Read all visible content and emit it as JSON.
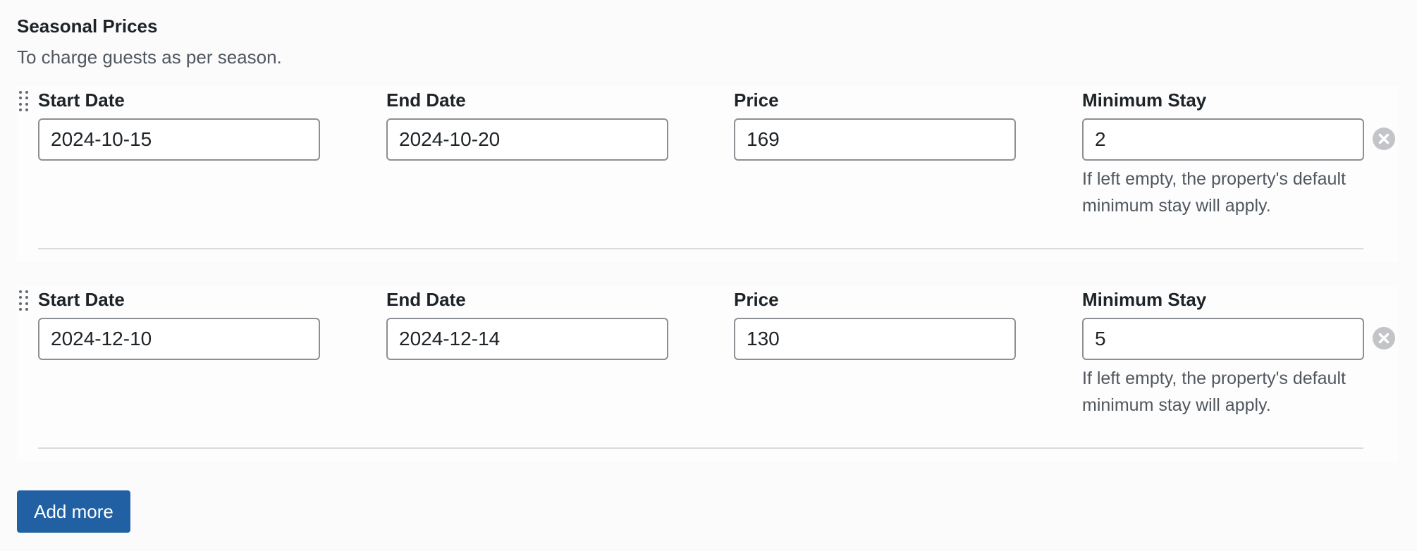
{
  "section": {
    "title": "Seasonal Prices",
    "description": "To charge guests as per season."
  },
  "labels": {
    "start_date": "Start Date",
    "end_date": "End Date",
    "price": "Price",
    "minimum_stay": "Minimum Stay"
  },
  "minimum_stay_hint": "If left empty, the property's default minimum stay will apply.",
  "rows": [
    {
      "start_date": "2024-10-15",
      "end_date": "2024-10-20",
      "price": "169",
      "minimum_stay": "2"
    },
    {
      "start_date": "2024-12-10",
      "end_date": "2024-12-14",
      "price": "130",
      "minimum_stay": "5"
    }
  ],
  "icons": {
    "drag": "drag-handle-icon",
    "remove": "remove-circle-icon"
  },
  "add_more_label": "Add more",
  "colors": {
    "primary_button": "#2260a4",
    "remove_icon": "#c3c4c7",
    "input_border": "#8c8f94"
  }
}
